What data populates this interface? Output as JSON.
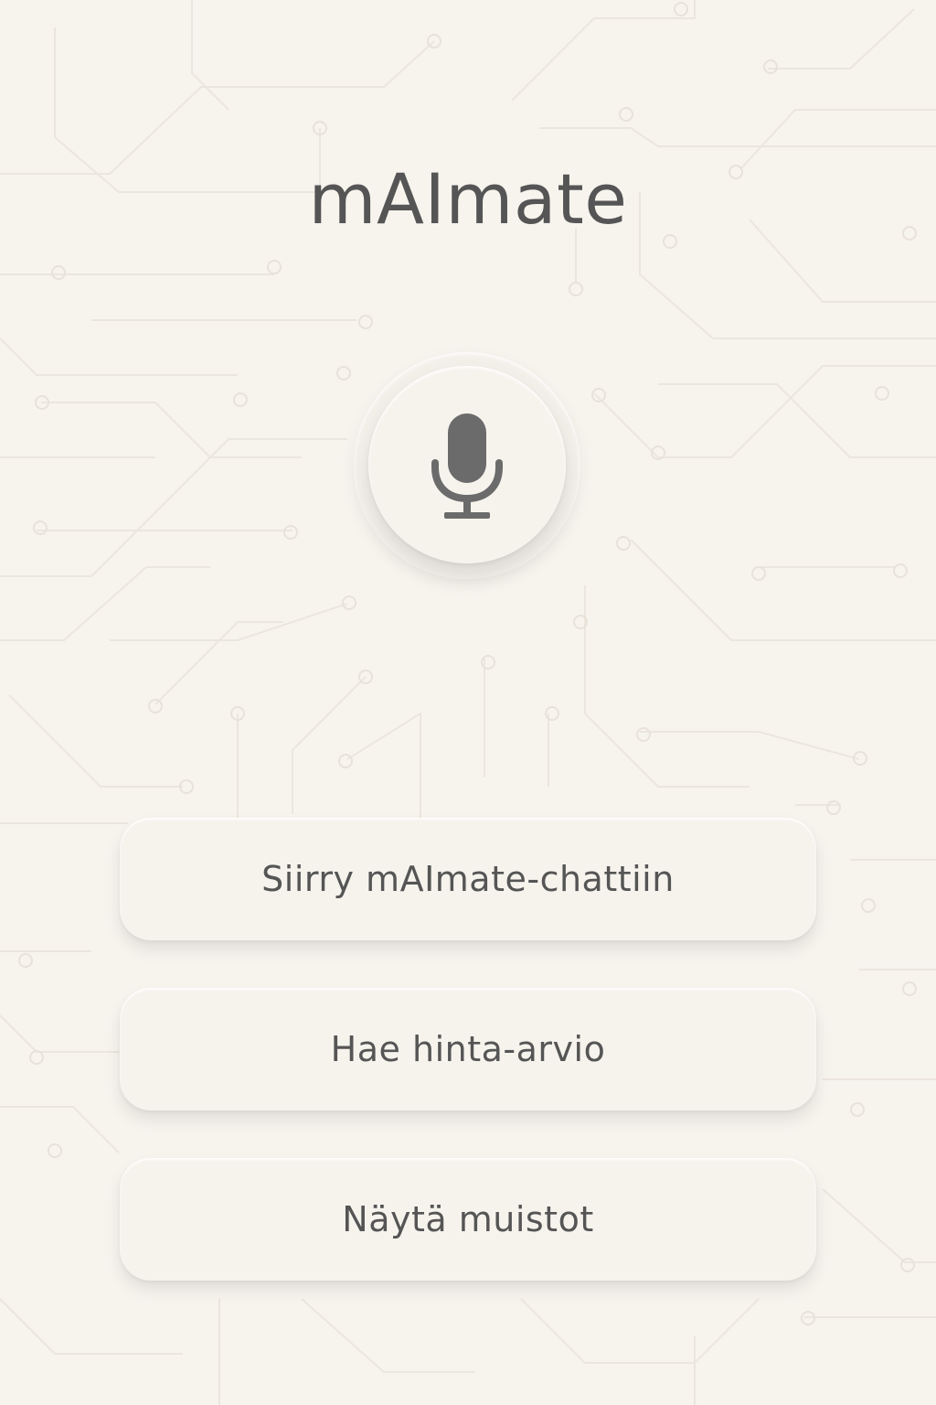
{
  "app": {
    "title": "mAImate"
  },
  "mic": {
    "icon": "microphone-icon"
  },
  "actions": [
    {
      "label": "Siirry mAImate-chattiin"
    },
    {
      "label": "Hae hinta-arvio"
    },
    {
      "label": "Näytä muistot"
    }
  ],
  "colors": {
    "background": "#f7f4ee",
    "surface": "#f6f3ed",
    "text": "#555555",
    "icon": "#6b6b6b"
  }
}
